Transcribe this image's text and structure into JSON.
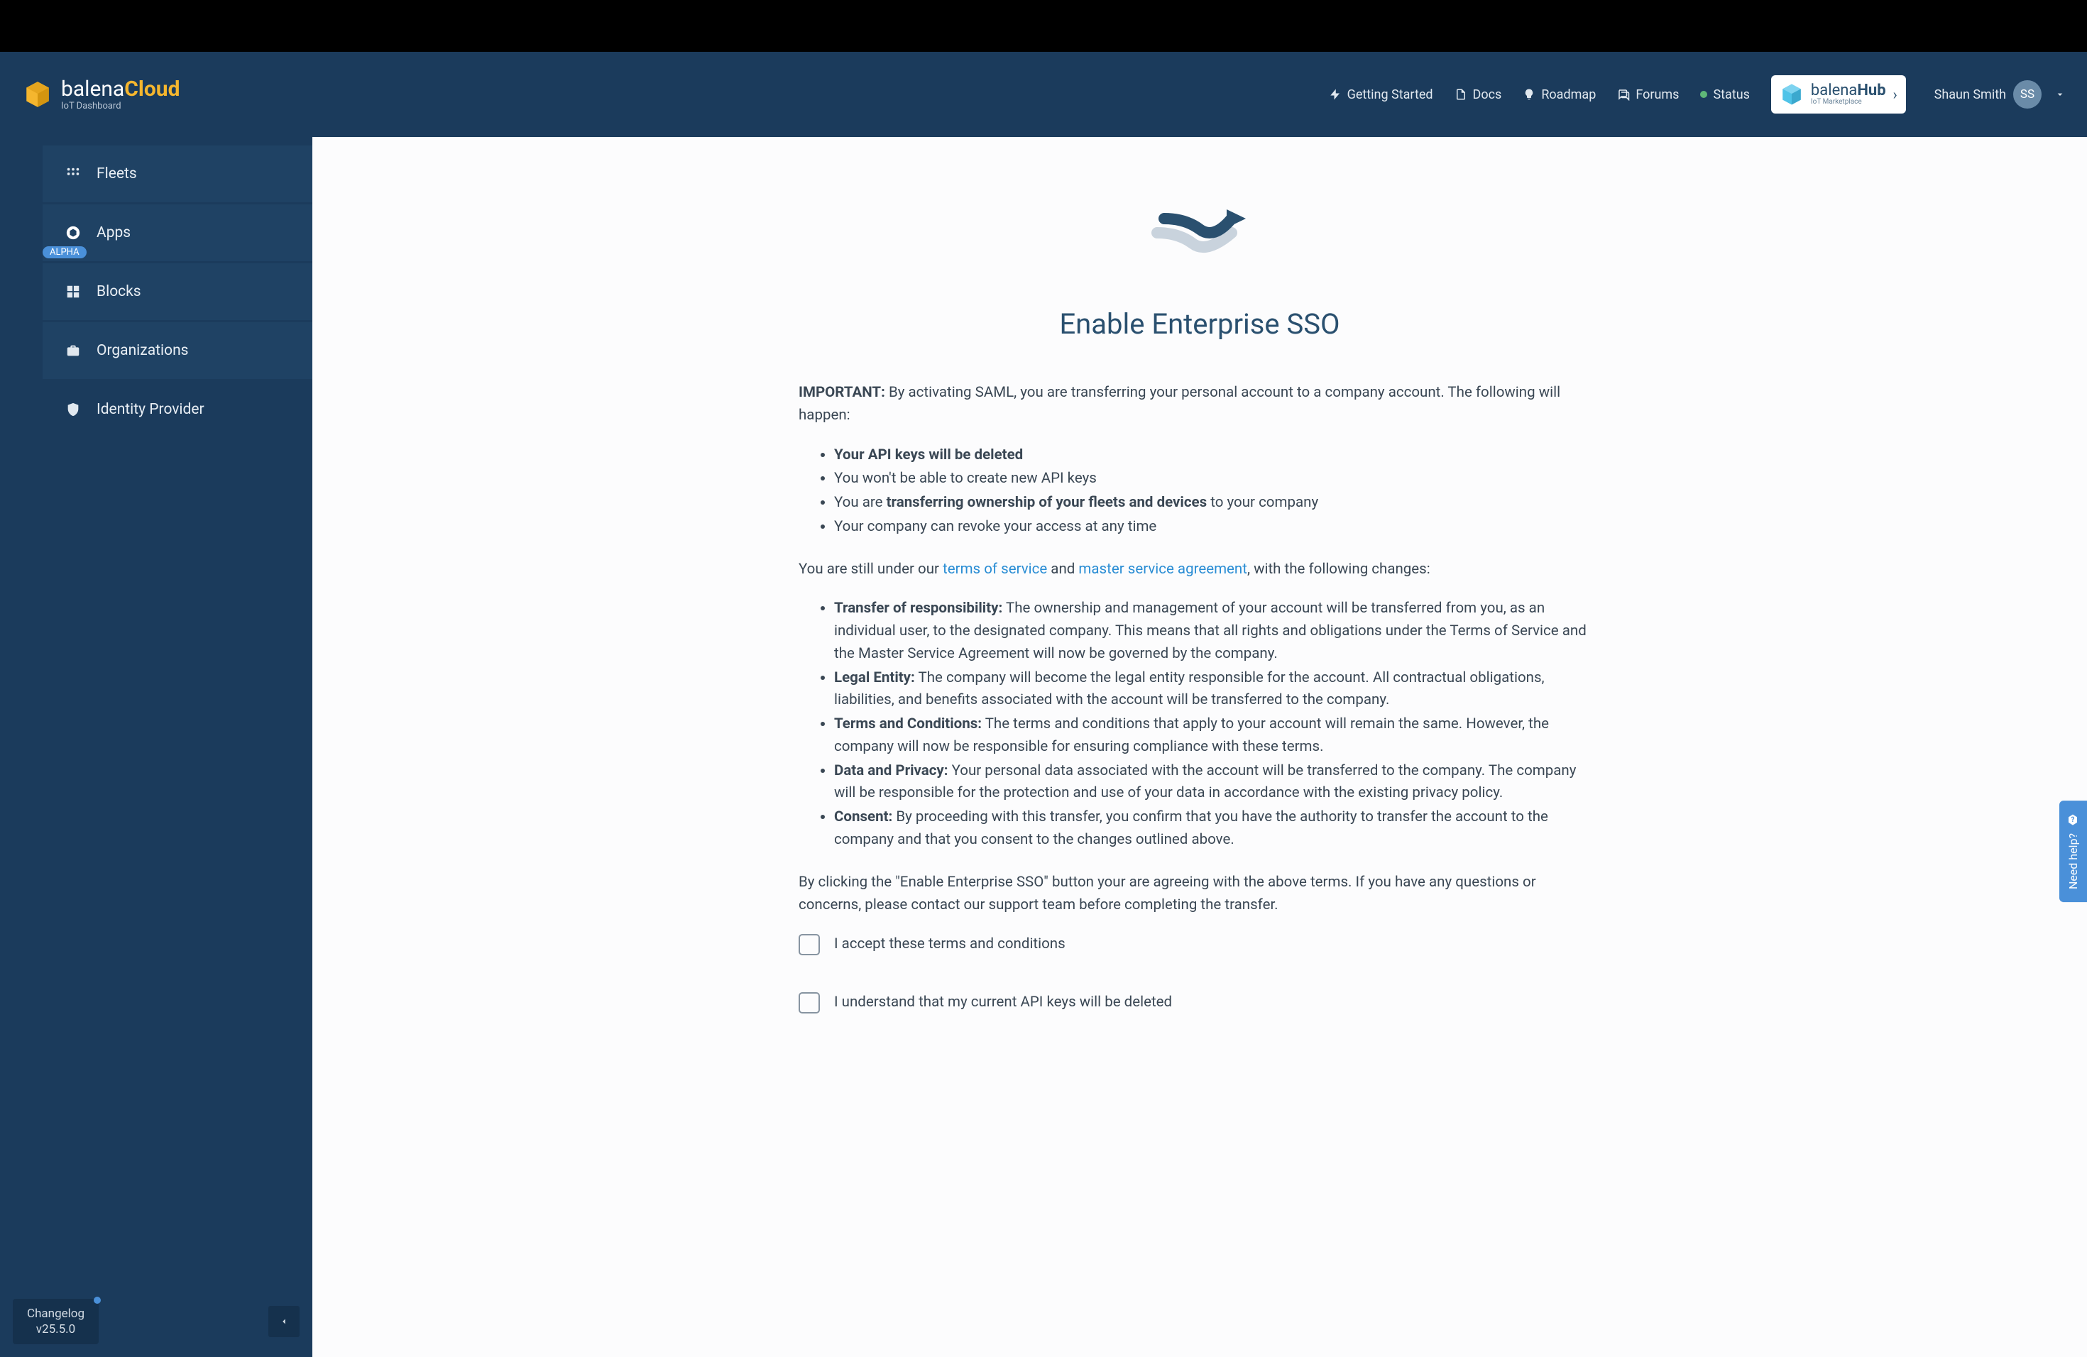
{
  "brand": {
    "name_part1": "balena",
    "name_part2": "Cloud",
    "subtitle": "IoT Dashboard"
  },
  "header_nav": {
    "getting_started": "Getting Started",
    "docs": "Docs",
    "roadmap": "Roadmap",
    "forums": "Forums",
    "status": "Status"
  },
  "hub": {
    "name_part1": "balena",
    "name_part2": "Hub",
    "subtitle": "IoT Marketplace"
  },
  "user": {
    "name": "Shaun Smith",
    "initials": "SS"
  },
  "sidebar": {
    "items": [
      {
        "label": "Fleets"
      },
      {
        "label": "Apps",
        "badge": "ALPHA"
      },
      {
        "label": "Blocks"
      },
      {
        "label": "Organizations"
      },
      {
        "label": "Identity Provider"
      }
    ]
  },
  "changelog": {
    "label": "Changelog",
    "version": "v25.5.0"
  },
  "page": {
    "title": "Enable Enterprise SSO",
    "important_label": "IMPORTANT:",
    "important_text": " By activating SAML, you are transferring your personal account to a company account. The following will happen:",
    "bullets_1": {
      "a": "Your API keys will be deleted",
      "b": "You won't be able to create new API keys",
      "c_pre": "You are ",
      "c_bold": "transferring ownership of your fleets and devices",
      "c_post": " to your company",
      "d": "Your company can revoke your access at any time"
    },
    "still_under_pre": "You are still under our ",
    "tos_link": "terms of service",
    "and_text": " and ",
    "msa_link": "master service agreement",
    "still_under_post": ", with the following changes:",
    "bullets_2": {
      "a_title": "Transfer of responsibility:",
      "a_text": " The ownership and management of your account will be transferred from you, as an individual user, to the designated company. This means that all rights and obligations under the Terms of Service and the Master Service Agreement will now be governed by the company.",
      "b_title": "Legal Entity:",
      "b_text": " The company will become the legal entity responsible for the account. All contractual obligations, liabilities, and benefits associated with the account will be transferred to the company.",
      "c_title": "Terms and Conditions:",
      "c_text": " The terms and conditions that apply to your account will remain the same. However, the company will now be responsible for ensuring compliance with these terms.",
      "d_title": "Data and Privacy:",
      "d_text": " Your personal data associated with the account will be transferred to the company. The company will be responsible for the protection and use of your data in accordance with the existing privacy policy.",
      "e_title": "Consent:",
      "e_text": " By proceeding with this transfer, you confirm that you have the authority to transfer the account to the company and that you consent to the changes outlined above."
    },
    "footer_text": "By clicking the \"Enable Enterprise SSO\" button your are agreeing with the above terms. If you have any questions or concerns, please contact our support team before completing the transfer.",
    "checkbox_1": "I accept these terms and conditions",
    "checkbox_2": "I understand that my current API keys will be deleted"
  },
  "help_tab": "Need help?"
}
